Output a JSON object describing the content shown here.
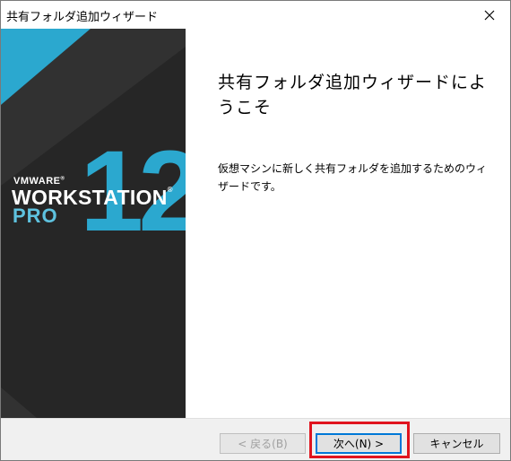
{
  "window": {
    "title": "共有フォルダ追加ウィザード"
  },
  "banner": {
    "brand": "VMWARE",
    "product": "WORKSTATION",
    "edition": "PRO",
    "version": "12",
    "registered": "®"
  },
  "content": {
    "heading": "共有フォルダ追加ウィザードにようこそ",
    "description": "仮想マシンに新しく共有フォルダを追加するためのウィザードです。"
  },
  "buttons": {
    "back": "< 戻る(B)",
    "next": "次へ(N) >",
    "cancel": "キャンセル"
  },
  "colors": {
    "banner_bg": "#262626",
    "accent_blue": "#2ba8cf",
    "highlight": "#e0141e"
  }
}
